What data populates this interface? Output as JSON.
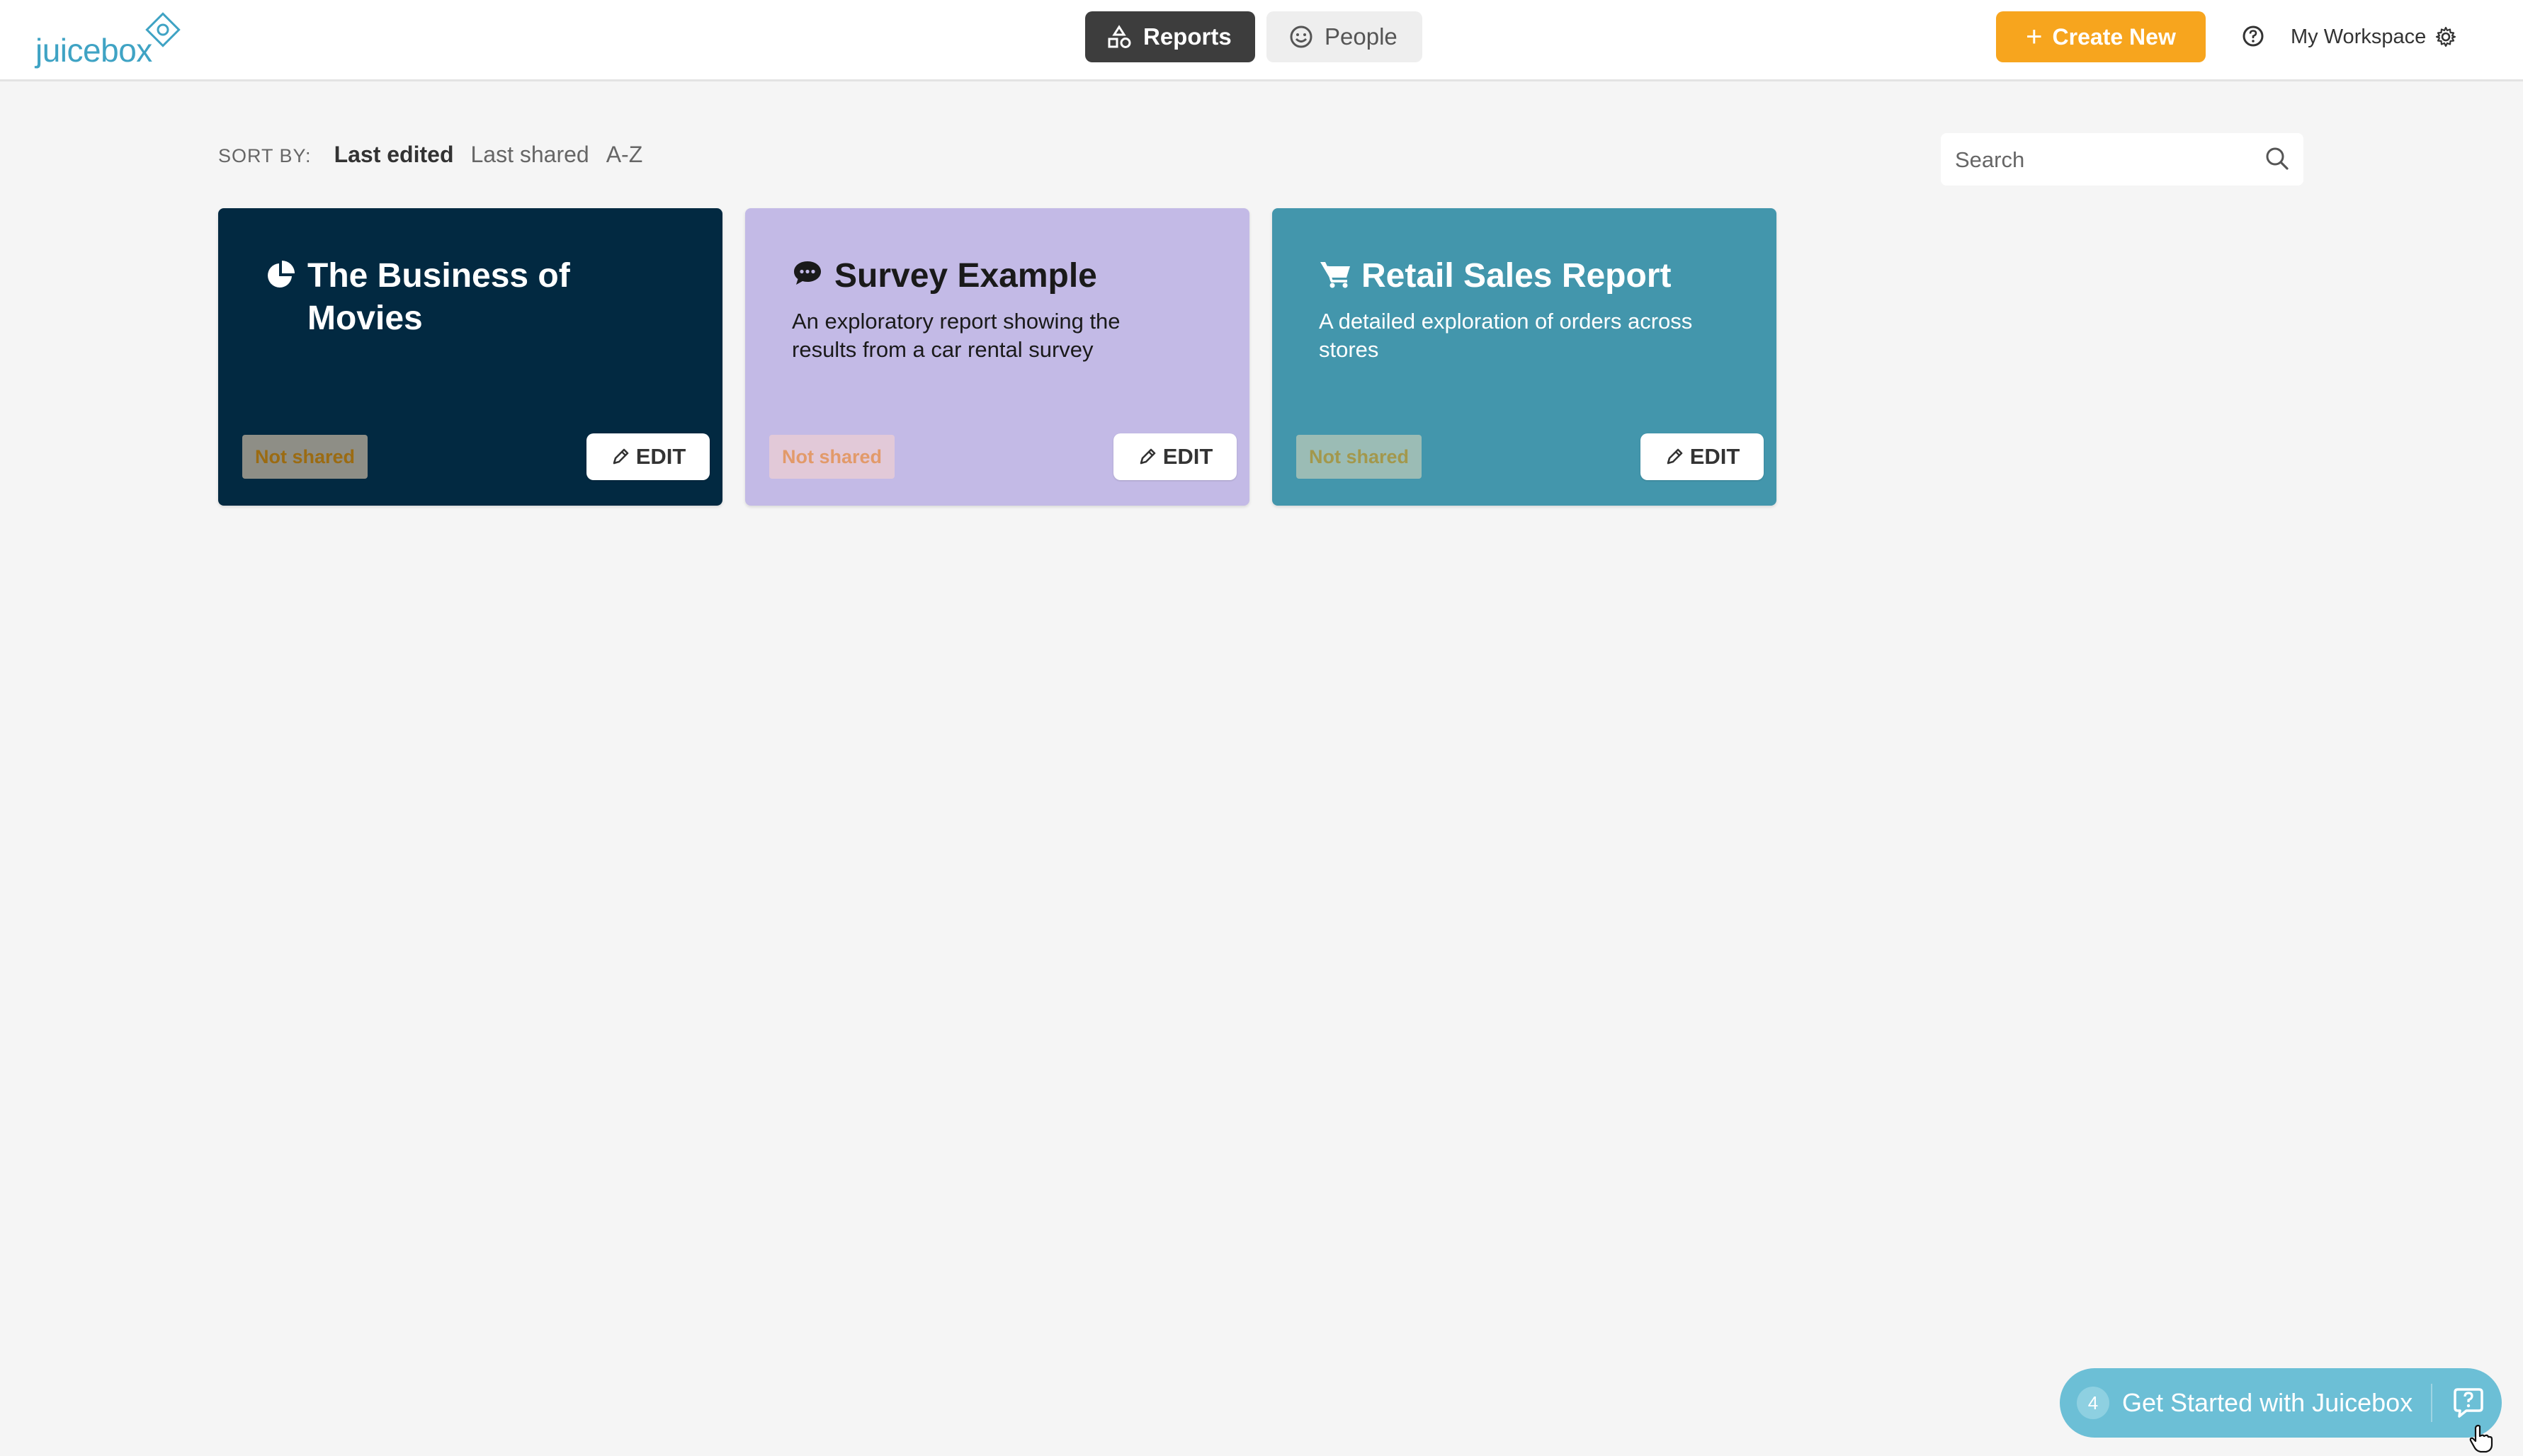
{
  "app": {
    "logo_text": "juicebox",
    "brand_color": "#3fa3c4"
  },
  "nav": {
    "tabs": [
      {
        "label": "Reports",
        "icon": "shapes-icon",
        "active": true
      },
      {
        "label": "People",
        "icon": "smiley-icon",
        "active": false
      }
    ]
  },
  "header": {
    "create_label": "Create New",
    "create_color": "#f7a51e",
    "help_icon": "question-circle-icon",
    "workspace_label": "My Workspace",
    "workspace_icon": "gear-icon"
  },
  "sort": {
    "label": "SORT BY:",
    "options": [
      "Last edited",
      "Last shared",
      "A-Z"
    ],
    "active": "Last edited"
  },
  "search": {
    "placeholder": "Search",
    "icon": "search-icon"
  },
  "cards": [
    {
      "title": "The Business of Movies",
      "description": "",
      "icon": "pie-chart-icon",
      "status": "Not shared",
      "edit_label": "EDIT",
      "color": "#022941"
    },
    {
      "title": "Survey Example",
      "description": "An exploratory report showing the results from a car rental survey",
      "icon": "speech-bubble-icon",
      "status": "Not shared",
      "edit_label": "EDIT",
      "color": "#c3bae6"
    },
    {
      "title": "Retail Sales Report",
      "description": "A detailed exploration of orders across stores",
      "icon": "shopping-cart-icon",
      "status": "Not shared",
      "edit_label": "EDIT",
      "color": "#4396ac"
    }
  ],
  "get_started": {
    "count": "4",
    "label": "Get Started with Juicebox",
    "icon": "help-chat-icon"
  }
}
